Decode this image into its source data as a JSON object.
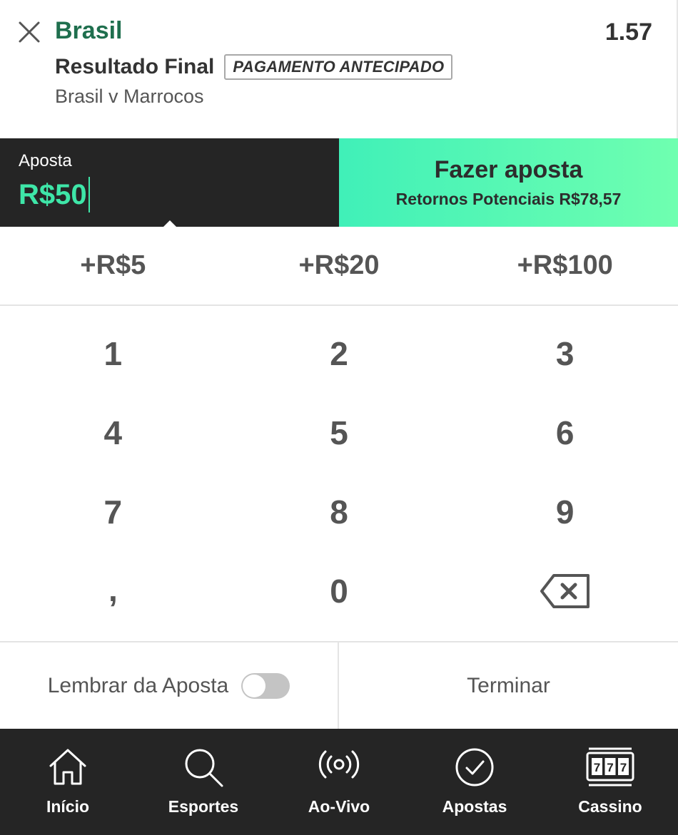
{
  "selection": {
    "name": "Brasil",
    "odds": "1.57",
    "market": "Resultado Final",
    "badge": "PAGAMENTO ANTECIPADO",
    "event": "Brasil v Marrocos"
  },
  "stake": {
    "label": "Aposta",
    "value": "R$50"
  },
  "place_bet": {
    "title": "Fazer aposta",
    "returns": "Retornos Potenciais R$78,57"
  },
  "quick_stakes": [
    "+R$5",
    "+R$20",
    "+R$100"
  ],
  "keypad": {
    "k1": "1",
    "k2": "2",
    "k3": "3",
    "k4": "4",
    "k5": "5",
    "k6": "6",
    "k7": "7",
    "k8": "8",
    "k9": "9",
    "comma": ",",
    "k0": "0"
  },
  "footer": {
    "remember_label": "Lembrar da Aposta",
    "done_label": "Terminar"
  },
  "nav": {
    "home": "Início",
    "sports": "Esportes",
    "live": "Ao-Vivo",
    "bets": "Apostas",
    "casino": "Cassino"
  },
  "colors": {
    "accent_green": "#3ee6a8",
    "selection_green": "#1f6f4e",
    "dark": "#252525"
  }
}
